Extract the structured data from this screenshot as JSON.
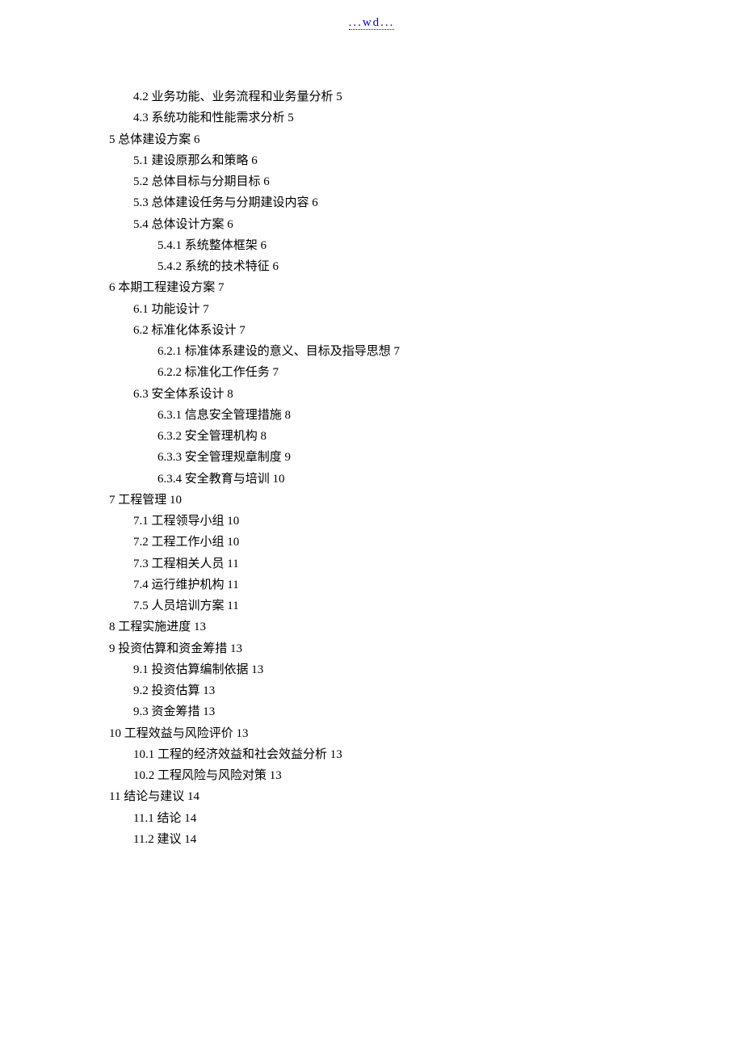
{
  "header_link": "...wd...",
  "toc": [
    {
      "level": 2,
      "text": "4.2 业务功能、业务流程和业务量分析 5"
    },
    {
      "level": 2,
      "text": "4.3 系统功能和性能需求分析 5"
    },
    {
      "level": 1,
      "text": "5 总体建设方案 6"
    },
    {
      "level": 2,
      "text": "5.1 建设原那么和策略 6"
    },
    {
      "level": 2,
      "text": "5.2 总体目标与分期目标 6"
    },
    {
      "level": 2,
      "text": "5.3 总体建设任务与分期建设内容 6"
    },
    {
      "level": 2,
      "text": "5.4 总体设计方案 6"
    },
    {
      "level": 3,
      "text": "5.4.1 系统整体框架 6"
    },
    {
      "level": 3,
      "text": "5.4.2 系统的技术特征 6"
    },
    {
      "level": 1,
      "text": "6 本期工程建设方案 7"
    },
    {
      "level": 2,
      "text": "6.1 功能设计 7"
    },
    {
      "level": 2,
      "text": "6.2 标准化体系设计 7"
    },
    {
      "level": 3,
      "text": "6.2.1 标准体系建设的意义、目标及指导思想 7"
    },
    {
      "level": 3,
      "text": "6.2.2 标准化工作任务 7"
    },
    {
      "level": 2,
      "text": "6.3 安全体系设计 8"
    },
    {
      "level": 3,
      "text": "6.3.1 信息安全管理措施 8"
    },
    {
      "level": 3,
      "text": "6.3.2 安全管理机构 8"
    },
    {
      "level": 3,
      "text": "6.3.3 安全管理规章制度 9"
    },
    {
      "level": 3,
      "text": "6.3.4 安全教育与培训 10"
    },
    {
      "level": 1,
      "text": "7 工程管理 10"
    },
    {
      "level": 2,
      "text": "7.1 工程领导小组 10"
    },
    {
      "level": 2,
      "text": "7.2 工程工作小组 10"
    },
    {
      "level": 2,
      "text": "7.3 工程相关人员 11"
    },
    {
      "level": 2,
      "text": "7.4 运行维护机构 11"
    },
    {
      "level": 2,
      "text": "7.5 人员培训方案 11"
    },
    {
      "level": 1,
      "text": "8 工程实施进度 13"
    },
    {
      "level": 1,
      "text": "9 投资估算和资金筹措 13"
    },
    {
      "level": 2,
      "text": "9.1 投资估算编制依据 13"
    },
    {
      "level": 2,
      "text": "9.2 投资估算 13"
    },
    {
      "level": 2,
      "text": "9.3 资金筹措 13"
    },
    {
      "level": 1,
      "text": "10 工程效益与风险评价 13"
    },
    {
      "level": 2,
      "text": "10.1 工程的经济效益和社会效益分析 13"
    },
    {
      "level": 2,
      "text": "10.2 工程风险与风险对策 13"
    },
    {
      "level": 1,
      "text": "11 结论与建议 14"
    },
    {
      "level": 2,
      "text": "11.1 结论 14"
    },
    {
      "level": 2,
      "text": "11.2 建议 14"
    }
  ]
}
